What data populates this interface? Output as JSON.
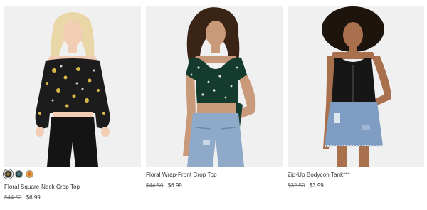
{
  "products": [
    {
      "name": "Floral Square-Neck Crop Top",
      "old_price": "$44.50",
      "price": "$6.99",
      "swatches": [
        {
          "icon": "swatch-black-floral",
          "color": "#2b2b2b",
          "selected": true
        },
        {
          "icon": "swatch-teal-floral",
          "color": "#1f3f3f",
          "selected": false
        },
        {
          "icon": "swatch-orange-floral",
          "color": "#e8a23a",
          "selected": false
        }
      ],
      "top_color": "#1c1c1c",
      "bottom_color": "#141414",
      "hair_color": "#e9d7a8"
    },
    {
      "name": "Floral Wrap-Front Crop Top",
      "old_price": "$44.50",
      "price": "$6.99",
      "top_color": "#153a2e",
      "bottom_color": "#8fa9c9",
      "hair_color": "#3a2416"
    },
    {
      "name": "Zip-Up Bodycon Tank***",
      "old_price": "$32.50",
      "price": "$3.99",
      "top_color": "#161616",
      "bottom_color": "#7f9cc2",
      "hair_color": "#1e140e"
    }
  ]
}
